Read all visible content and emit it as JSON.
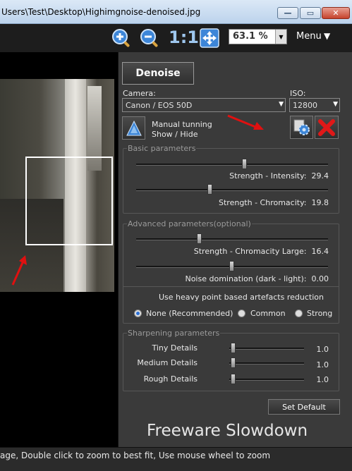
{
  "window": {
    "title": "Users\\Test\\Desktop\\Highimgnoise-denoised.jpg",
    "minimize_label": "—",
    "maximize_label": "▭",
    "close_label": "✕"
  },
  "toolbar": {
    "zoom_in_icon": "zoom-in-icon",
    "zoom_out_icon": "zoom-out-icon",
    "actual_size_label": "1:1",
    "fit_icon": "fit-to-window-icon",
    "zoom_value": "63.1 %",
    "menu_label": "Menu"
  },
  "panel": {
    "denoise_label": "Denoise",
    "camera_label": "Camera:",
    "camera_value": "Canon / EOS 50D",
    "iso_label": "ISO:",
    "iso_value": "12800",
    "manual_tuning_line1": "Manual tunning",
    "manual_tuning_line2": "Show / Hide",
    "basic": {
      "title": "Basic parameters",
      "intensity_label": "Strength - Intensity:",
      "intensity_value": "29.4",
      "intensity_level": 0.52,
      "chromacity_label": "Strength - Chromacity:",
      "chromacity_value": "19.8",
      "chromacity_level": 0.38
    },
    "advanced": {
      "title": "Advanced parameters(optional)",
      "chroma_large_label": "Strength - Chromacity Large:",
      "chroma_large_value": "16.4",
      "chroma_large_level": 0.33,
      "noise_dom_label": "Noise domination (dark - light):",
      "noise_dom_value": "0.00",
      "noise_dom_level": 0.5,
      "artefacts_label": "Use heavy point based artefacts reduction",
      "options": [
        "None (Recommended)",
        "Common",
        "Strong"
      ],
      "selected_option": "None (Recommended)"
    },
    "sharpening": {
      "title": "Sharpening parameters",
      "tiny_label": "Tiny Details",
      "tiny_value": "1.0",
      "medium_label": "Medium Details",
      "medium_value": "1.0",
      "rough_label": "Rough Details",
      "rough_value": "1.0",
      "level": 0.06
    },
    "set_default_label": "Set Default",
    "freeware_text": "Freeware Slowdown"
  },
  "status": {
    "text": "age, Double click to zoom to best fit, Use mouse wheel to zoom"
  },
  "colors": {
    "panel_bg": "#3a3a3a",
    "toolbar_bg": "#1d1d1d",
    "arrow_red": "#e01010",
    "radio_selected": "#2a6fd6"
  }
}
